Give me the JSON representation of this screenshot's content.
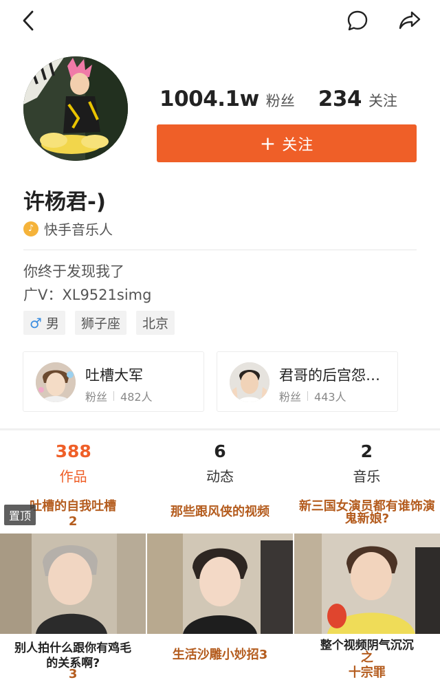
{
  "profile": {
    "followers_count": "1004.1w",
    "followers_label": "粉丝",
    "following_count": "234",
    "following_label": "关注",
    "follow_button": "关注",
    "name": "许杨君-)",
    "badge": "快手音乐人",
    "bio_line1": "你终于发现我了",
    "bio_line2": "广V：XL9521simg",
    "tags": [
      "男",
      "狮子座",
      "北京"
    ]
  },
  "fan_groups": [
    {
      "title": "吐槽大军",
      "label": "粉丝",
      "count": "482人"
    },
    {
      "title": "君哥的后宫怨…",
      "label": "粉丝",
      "count": "443人"
    }
  ],
  "tabs": [
    {
      "count": "388",
      "label": "作品"
    },
    {
      "count": "6",
      "label": "动态"
    },
    {
      "count": "2",
      "label": "音乐"
    }
  ],
  "videos": [
    {
      "pin": "置顶",
      "top_caption_a": "吐槽的自我吐槽",
      "top_caption_b": "2",
      "bottom_caption_a": "别人拍什么跟你有鸡毛",
      "bottom_caption_b": "的关系啊?",
      "bottom_caption_c": "3"
    },
    {
      "top_caption_a": "那些跟风侠的视频",
      "bottom_caption_a": "生活沙雕小妙招3"
    },
    {
      "top_caption_a": "新三国女演员都有谁饰演",
      "top_caption_b": "鬼新娘?",
      "bottom_caption_a": "整个视频阴气沉沉",
      "bottom_caption_b": "之",
      "bottom_caption_c": "十宗罪"
    }
  ],
  "colors": {
    "accent": "#ef5f28",
    "badge": "#f5b33a",
    "male": "#3b8de0"
  }
}
